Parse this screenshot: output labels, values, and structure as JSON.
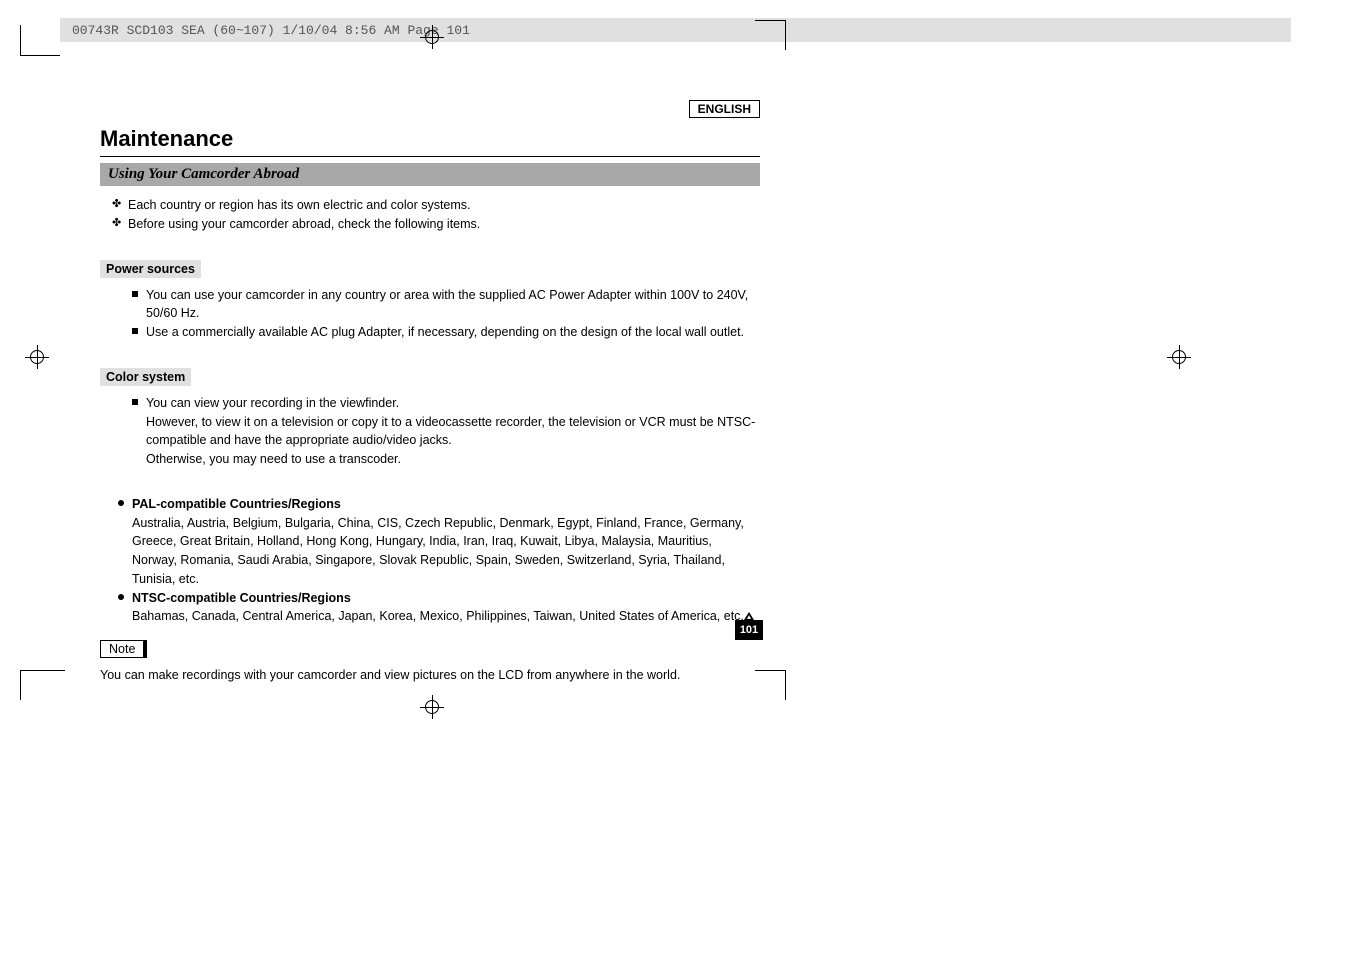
{
  "header": {
    "slug": "00743R SCD103 SEA (60~107)  1/10/04 8:56 AM  Page 101"
  },
  "language_badge": "ENGLISH",
  "main_title": "Maintenance",
  "subtitle": "Using Your Camcorder Abroad",
  "intro": [
    "Each country or region has its own electric and color systems.",
    "Before using your camcorder abroad, check the following items."
  ],
  "sections": {
    "power": {
      "heading": "Power sources",
      "items": [
        "You can use your camcorder in any country or area with the supplied AC Power Adapter within 100V to 240V, 50/60 Hz.",
        "Use a commercially available AC plug Adapter, if necessary, depending on the design of the local wall outlet."
      ]
    },
    "color": {
      "heading": "Color system",
      "item_first": "You can view your recording in the viewfinder.",
      "item_cont1": "However, to view it on a television or copy it to a videocassette recorder, the television or VCR must be NTSC-compatible and have the appropriate audio/video jacks.",
      "item_cont2": "Otherwise, you may need to use a transcoder."
    },
    "regions": [
      {
        "label": "PAL-compatible Countries/Regions",
        "detail": "Australia, Austria, Belgium, Bulgaria, China, CIS, Czech Republic, Denmark, Egypt, Finland, France, Germany, Greece, Great Britain, Holland, Hong Kong, Hungary, India, Iran, Iraq, Kuwait, Libya, Malaysia, Mauritius, Norway, Romania, Saudi Arabia, Singapore, Slovak Republic, Spain, Sweden, Switzerland, Syria, Thailand, Tunisia, etc."
      },
      {
        "label": "NTSC-compatible Countries/Regions",
        "detail": "Bahamas, Canada, Central America, Japan, Korea, Mexico, Philippines, Taiwan, United States of America, etc."
      }
    ]
  },
  "note": {
    "label": "Note",
    "text": "You can make recordings with your camcorder and view pictures on the LCD from anywhere in the world."
  },
  "page_number": "101"
}
